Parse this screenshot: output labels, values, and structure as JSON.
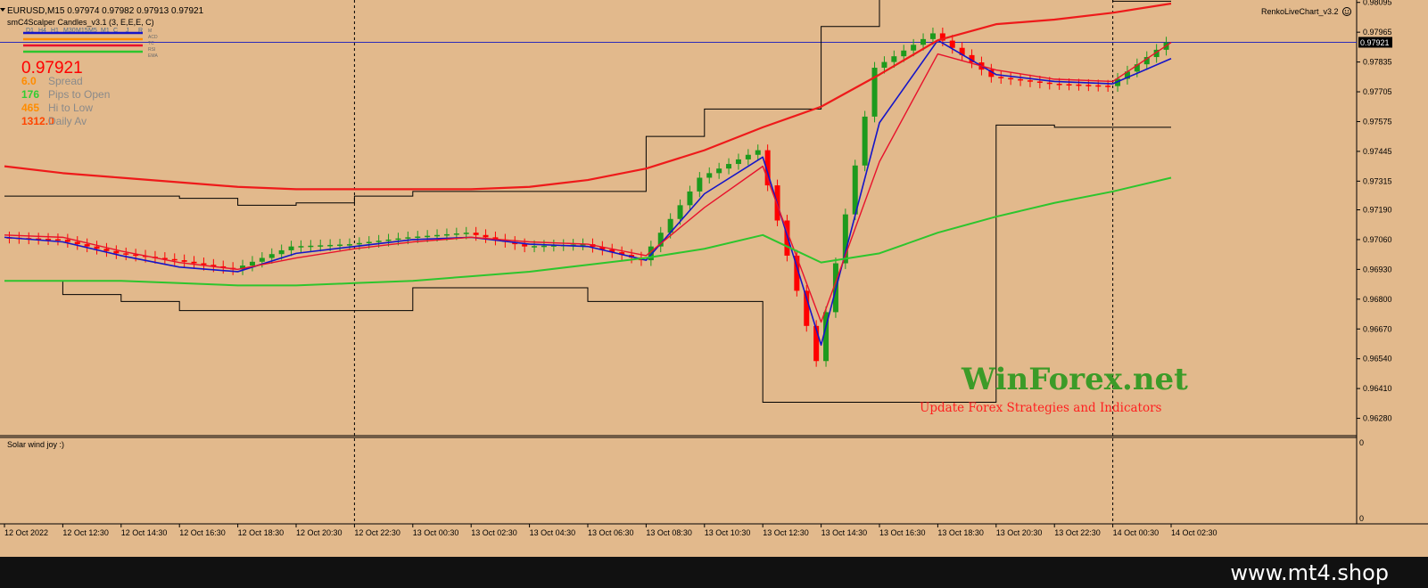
{
  "header": {
    "symbol_line": "EURUSD,M15  0.97974 0.97982 0.97913 0.97921",
    "indicator_name": "smC4Scalper Candles_v3.1 (3, E,E,E, C)",
    "tf_labels": [
      "D1",
      "H4",
      "H1",
      "M30",
      "M15",
      "M5",
      "M1",
      "C",
      "J",
      "R"
    ],
    "ind_labels": [
      "M",
      "ACD",
      "TC",
      "RSI",
      "EMA"
    ],
    "top_right_label": "RenkoLiveChart_v3.2"
  },
  "info_panel": {
    "price": "0.97921",
    "rows": [
      {
        "value": "6.0",
        "label": "Spread",
        "color": "#ff8c00"
      },
      {
        "value": "176",
        "label": "Pips to Open",
        "color": "#32cd32"
      },
      {
        "value": "465",
        "label": "Hi to Low",
        "color": "#ff8c00"
      },
      {
        "value": "1312.0",
        "label": "Daily Av",
        "color": "#ff4500"
      }
    ],
    "price_color": "#ff0000"
  },
  "watermark": {
    "title": "WinForex.net",
    "subtitle": "Update Forex Strategies and Indicators"
  },
  "subwindow": {
    "label": "Solar wind joy :)",
    "scale_top": "0",
    "scale_bottom": "0"
  },
  "footer": {
    "text": "www.mt4.shop"
  },
  "colors": {
    "background": "#e2b98c",
    "bull": "#1d9a1d",
    "bear": "#ff0000",
    "fast_ma": "#1515c8",
    "mid_ma": "#e8122c",
    "slow_ma_green": "#2dc52d",
    "slow_ma_red": "#ee1a1a",
    "current_price_line": "#2b2bb8"
  },
  "chart_data": {
    "type": "line",
    "symbol": "EURUSD",
    "timeframe": "M15",
    "current_price": 0.97921,
    "ohlc_last": {
      "open": 0.97974,
      "high": 0.97982,
      "low": 0.97913,
      "close": 0.97921
    },
    "ylim": [
      0.9622,
      0.9809
    ],
    "y_ticks": [
      0.98095,
      0.97965,
      0.97835,
      0.97705,
      0.97575,
      0.97445,
      0.97315,
      0.9719,
      0.9706,
      0.9693,
      0.968,
      0.9667,
      0.9654,
      0.9641,
      0.9628
    ],
    "x_tick_labels": [
      "12 Oct 2022",
      "12 Oct 12:30",
      "12 Oct 14:30",
      "12 Oct 16:30",
      "12 Oct 18:30",
      "12 Oct 20:30",
      "12 Oct 22:30",
      "13 Oct 00:30",
      "13 Oct 02:30",
      "13 Oct 04:30",
      "13 Oct 06:30",
      "13 Oct 08:30",
      "13 Oct 10:30",
      "13 Oct 12:30",
      "13 Oct 14:30",
      "13 Oct 16:30",
      "13 Oct 18:30",
      "13 Oct 20:30",
      "13 Oct 22:30",
      "14 Oct 00:30",
      "14 Oct 02:30"
    ],
    "period_separators": [
      "12 Oct 22:30",
      "14 Oct 00:30"
    ],
    "price_series": [
      {
        "time": "12 Oct 2022",
        "close": 0.9707
      },
      {
        "time": "12 Oct 12:30",
        "close": 0.9706
      },
      {
        "time": "12 Oct 14:30",
        "close": 0.97
      },
      {
        "time": "12 Oct 16:30",
        "close": 0.9697
      },
      {
        "time": "12 Oct 18:30",
        "close": 0.9693
      },
      {
        "time": "12 Oct 20:30",
        "close": 0.9703
      },
      {
        "time": "12 Oct 22:30",
        "close": 0.9704
      },
      {
        "time": "13 Oct 00:30",
        "close": 0.9707
      },
      {
        "time": "13 Oct 02:30",
        "close": 0.9709
      },
      {
        "time": "13 Oct 04:30",
        "close": 0.9703
      },
      {
        "time": "13 Oct 06:30",
        "close": 0.9704
      },
      {
        "time": "13 Oct 08:30",
        "close": 0.9697
      },
      {
        "time": "13 Oct 10:30",
        "close": 0.9733
      },
      {
        "time": "13 Oct 12:30",
        "close": 0.9745
      },
      {
        "time": "13 Oct 14:30",
        "close": 0.9653
      },
      {
        "time": "13 Oct 16:30",
        "close": 0.9781
      },
      {
        "time": "13 Oct 18:30",
        "close": 0.9796
      },
      {
        "time": "13 Oct 20:30",
        "close": 0.9777
      },
      {
        "time": "13 Oct 22:30",
        "close": 0.9774
      },
      {
        "time": "14 Oct 00:30",
        "close": 0.9773
      },
      {
        "time": "14 Oct 02:30",
        "close": 0.9792
      }
    ],
    "series": [
      {
        "values": [
          0.9707,
          0.9705,
          0.9699,
          0.9694,
          0.9692,
          0.97,
          0.9703,
          0.9706,
          0.9707,
          0.9704,
          0.9703,
          0.9697,
          0.9726,
          0.9742,
          0.966,
          0.9757,
          0.9793,
          0.9778,
          0.9775,
          0.9774,
          0.9785
        ]
      },
      {
        "values": [
          0.9708,
          0.9707,
          0.9701,
          0.9696,
          0.9693,
          0.9698,
          0.9702,
          0.9705,
          0.9707,
          0.9705,
          0.9704,
          0.9699,
          0.972,
          0.9738,
          0.967,
          0.974,
          0.9787,
          0.978,
          0.9776,
          0.9775,
          0.9792
        ]
      },
      {
        "values": [
          0.9738,
          0.9735,
          0.9733,
          0.9731,
          0.9729,
          0.9728,
          0.9728,
          0.9728,
          0.9728,
          0.9729,
          0.9732,
          0.9737,
          0.9745,
          0.9755,
          0.9764,
          0.9778,
          0.9793,
          0.98,
          0.9802,
          0.9805,
          0.9809
        ]
      },
      {
        "values": [
          0.9688,
          0.9688,
          0.9688,
          0.9687,
          0.9686,
          0.9686,
          0.9687,
          0.9688,
          0.969,
          0.9692,
          0.9695,
          0.9698,
          0.9702,
          0.9708,
          0.9696,
          0.97,
          0.9709,
          0.9716,
          0.9722,
          0.9727,
          0.9733
        ]
      }
    ]
  }
}
